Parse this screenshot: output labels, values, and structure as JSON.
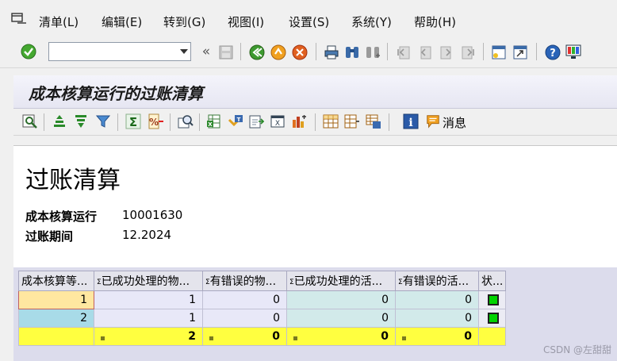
{
  "menu": [
    "清单(L)",
    "编辑(E)",
    "转到(G)",
    "视图(I)",
    "设置(S)",
    "系统(Y)",
    "帮助(H)"
  ],
  "command_field": {
    "value": ""
  },
  "page": {
    "title": "成本核算运行的过账清算"
  },
  "alv_toolbar": {
    "messages_label": "消息"
  },
  "report": {
    "heading": "过账清算",
    "fields": [
      {
        "label": "成本核算运行",
        "value": "10001630"
      },
      {
        "label": "过账期间",
        "value": "12.2024"
      }
    ]
  },
  "table": {
    "headers": [
      "成本核算等...",
      "已成功处理的物...",
      "有错误的物...",
      "已成功处理的活...",
      "有错误的活...",
      "状..."
    ],
    "rows": [
      {
        "level": "1",
        "mat_ok": "1",
        "mat_err": "0",
        "act_ok": "0",
        "act_err": "0",
        "status": "green"
      },
      {
        "level": "2",
        "mat_ok": "1",
        "mat_err": "0",
        "act_ok": "0",
        "act_err": "0",
        "status": "green"
      }
    ],
    "totals": {
      "mat_ok": "2",
      "mat_err": "0",
      "act_ok": "0",
      "act_err": "0"
    }
  },
  "watermark": "CSDN @左甜甜",
  "colors": {
    "status_green": "#00d400",
    "total_row": "#ffff40",
    "selected_cell": "#ffe7a0",
    "key_cell": "#a8dbe8"
  }
}
